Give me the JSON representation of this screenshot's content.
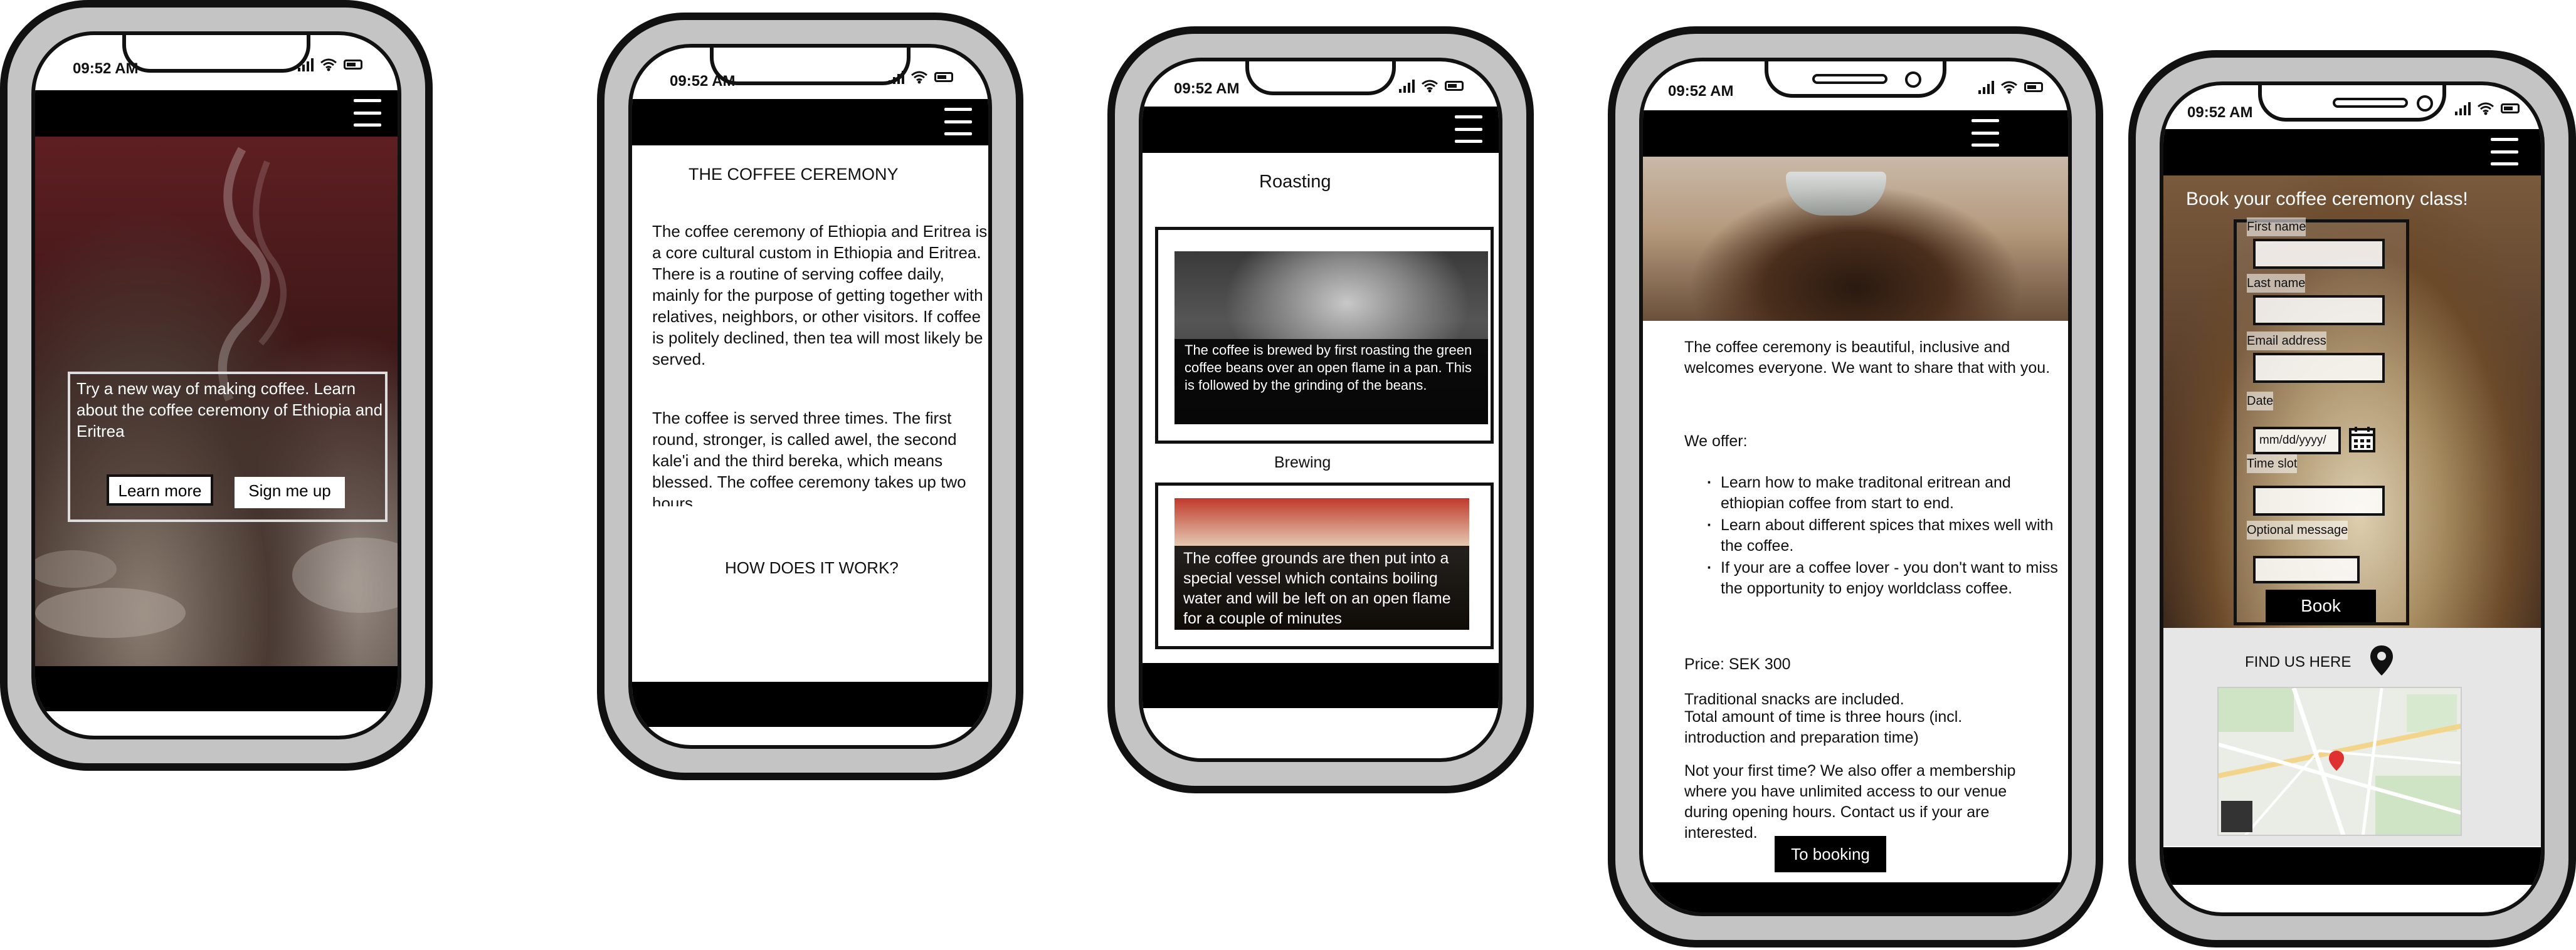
{
  "status": {
    "time": "09:52 AM"
  },
  "phone1": {
    "hero_text": "Try a new way of making coffee. Learn about the coffee ceremony of Ethiopia and Eritrea",
    "learn_more": "Learn more",
    "sign_me_up": "Sign me up"
  },
  "phone2": {
    "title": "THE COFFEE CEREMONY",
    "paragraph1": "The coffee ceremony of Ethiopia and Eritrea is a core cultural custom in Ethiopia and Eritrea. There is a routine of serving coffee daily, mainly for the purpose of getting together with relatives, neighbors, or other visitors. If coffee is politely declined, then tea will most likely be served.",
    "paragraph2": "The coffee is served three times. The first round, stronger, is called awel, the second kale'i and the third bereka, which means blessed. The coffee ceremony takes up two hours",
    "how_heading": "HOW DOES IT WORK?"
  },
  "phone3": {
    "roasting_heading": "Roasting",
    "roasting_caption": "The coffee is brewed by first roasting the green coffee beans over an open flame in a pan. This is followed by the grinding of the beans.",
    "brewing_heading": "Brewing",
    "brewing_caption": "The coffee grounds are then put into a special vessel which contains boiling water and will be left on an open flame for a couple of minutes"
  },
  "phone4": {
    "intro": "The coffee ceremony is beautiful, inclusive and welcomes everyone. We want to share that with you.",
    "offer_heading": "We offer:",
    "offers": [
      "Learn how to make traditonal eritrean and ethiopian coffee from start to end.",
      "Learn about different spices that mixes well with the coffee.",
      "If your are a coffee lover - you don't want to miss the opportunity to enjoy worldclass coffee."
    ],
    "price": "Price: SEK 300",
    "snacks": "Traditional snacks are included.",
    "duration": "Total amount of time is three hours (incl. introduction and preparation time)",
    "membership": "Not your first time? We also offer a membership where you have unlimited access to our venue during opening hours. Contact us if your are interested.",
    "to_booking": "To booking"
  },
  "phone5": {
    "booking_title": "Book your coffee ceremony class!",
    "form": {
      "first_name": "First name",
      "last_name": "Last name",
      "email": "Email address",
      "date": "Date",
      "date_placeholder": "mm/dd/yyyy/",
      "time_slot": "Time slot",
      "optional_message": "Optional message",
      "book": "Book"
    },
    "find_us": "FIND US HERE"
  },
  "icons": [
    "hamburger-menu-icon",
    "signal-icon",
    "wifi-icon",
    "battery-icon",
    "calendar-icon",
    "map-pin-icon"
  ],
  "colors": {
    "bar": "#000000",
    "frame": "#c4c4c4",
    "outline": "#111111"
  }
}
